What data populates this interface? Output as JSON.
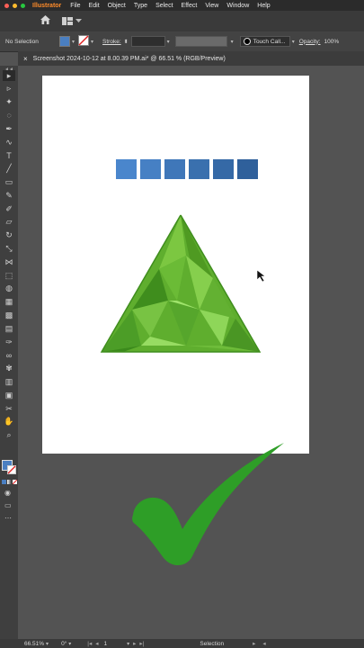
{
  "menubar": {
    "app_name": "Illustrator",
    "items": [
      "File",
      "Edit",
      "Object",
      "Type",
      "Select",
      "Effect",
      "View",
      "Window",
      "Help"
    ]
  },
  "controlbar": {
    "selection_label": "No Selection",
    "stroke_label": "Stroke:",
    "brush_label": "Touch Call...",
    "opacity_label": "Opacity:",
    "opacity_value": "100%"
  },
  "document": {
    "tab_title": "Screenshot 2024-10-12 at 8.00.39 PM.ai* @ 66.51 % (RGB/Preview)"
  },
  "statusbar": {
    "zoom": "66.51%",
    "rotation": "0°",
    "artboard_number": "1",
    "tool_name": "Selection"
  },
  "colors": {
    "fill_color": "#4a7fc1",
    "swatches": [
      "#4a86cc",
      "#4680c4",
      "#3f77b9",
      "#3a70ae",
      "#3569a6",
      "#2f609b"
    ],
    "triangle_green": "#5fae2e",
    "checkmark_green": "#2e9e27",
    "app_accent": "#ff8c2a"
  },
  "tools": [
    "selection-tool-icon",
    "direct-selection-tool-icon",
    "magic-wand-tool-icon",
    "lasso-tool-icon",
    "pen-tool-icon",
    "curvature-tool-icon",
    "type-tool-icon",
    "line-tool-icon",
    "rectangle-tool-icon",
    "paintbrush-tool-icon",
    "shaper-tool-icon",
    "eraser-tool-icon",
    "rotate-tool-icon",
    "scale-tool-icon",
    "width-tool-icon",
    "free-transform-tool-icon",
    "shape-builder-tool-icon",
    "perspective-grid-tool-icon",
    "mesh-tool-icon",
    "gradient-tool-icon",
    "eyedropper-tool-icon",
    "blend-tool-icon",
    "symbol-sprayer-tool-icon",
    "column-graph-tool-icon",
    "artboard-tool-icon",
    "slice-tool-icon",
    "hand-tool-icon",
    "zoom-tool-icon"
  ]
}
